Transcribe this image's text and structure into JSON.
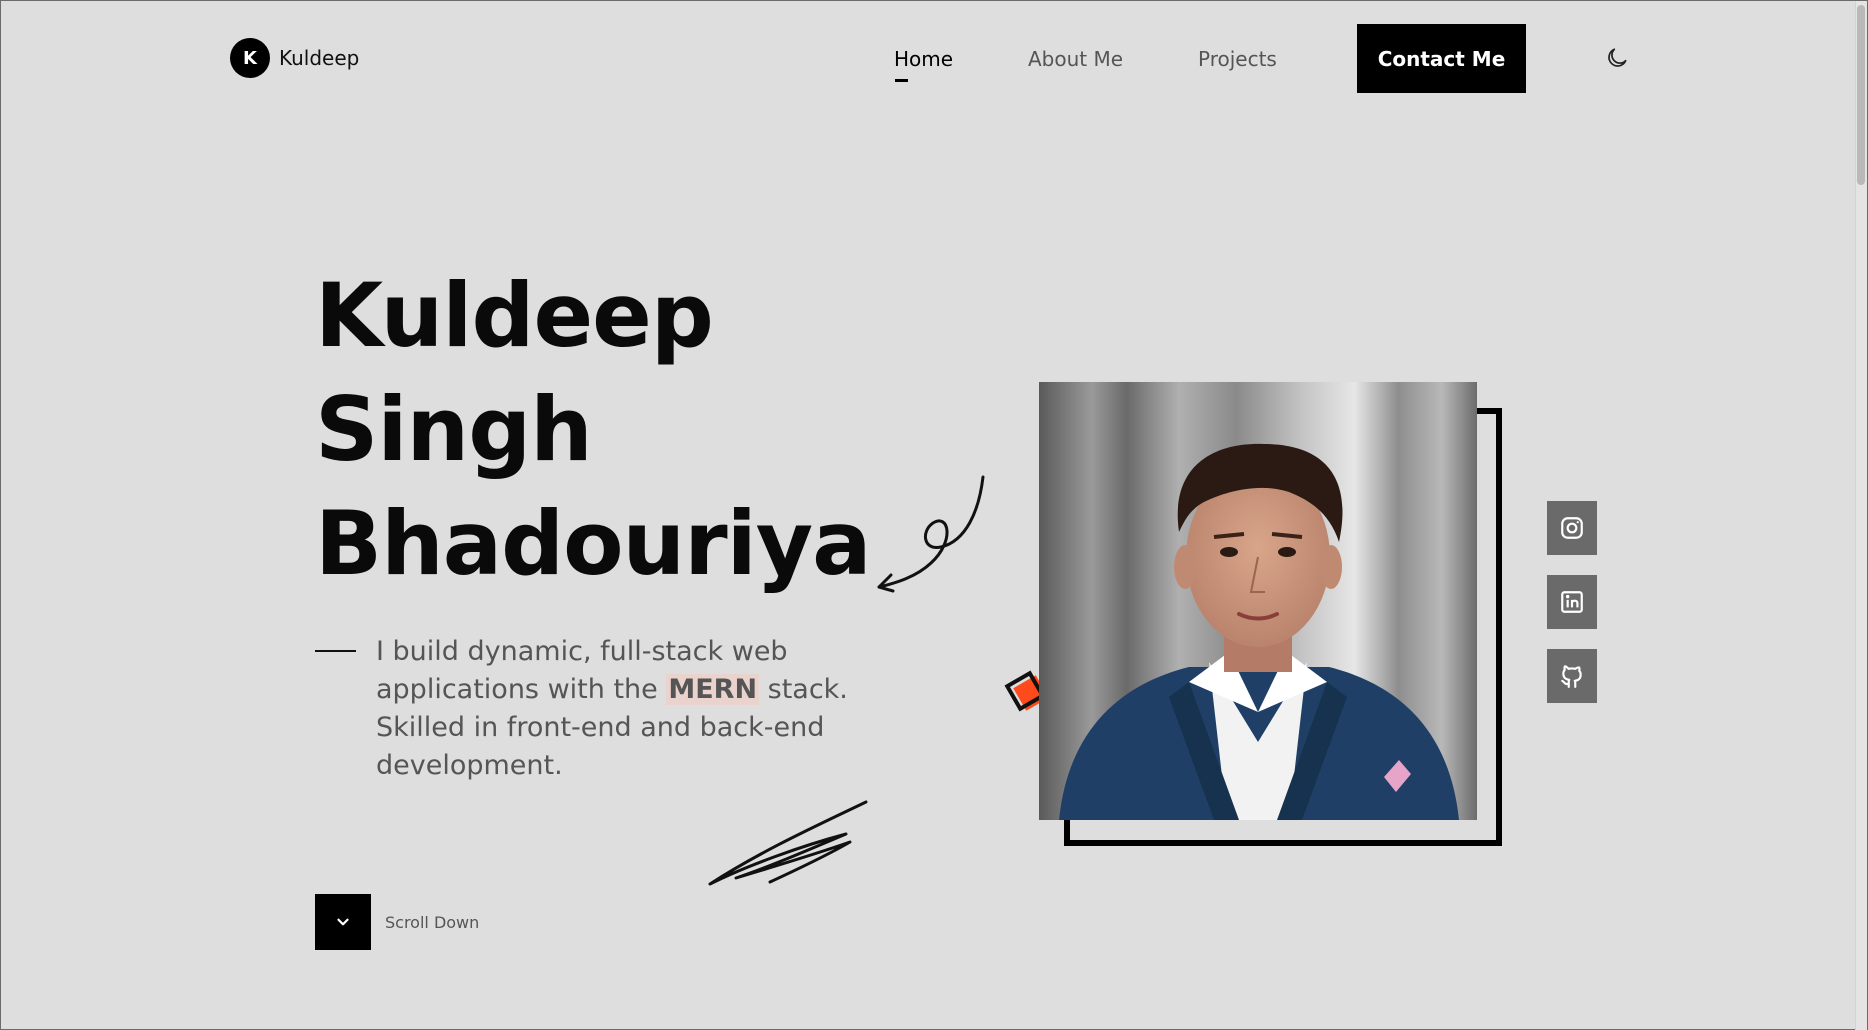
{
  "brand": {
    "logo_letter": "K",
    "name": "Kuldeep"
  },
  "nav": {
    "items": [
      {
        "label": "Home",
        "active": true
      },
      {
        "label": "About Me"
      },
      {
        "label": "Projects"
      }
    ],
    "contact_label": "Contact Me",
    "theme_icon": "moon-icon"
  },
  "hero": {
    "name_lines": [
      "Kuldeep",
      "Singh",
      "Bhadouriya"
    ],
    "description_before": "I build dynamic, full-stack web applications with the ",
    "description_highlight": "MERN",
    "description_after": " stack. Skilled in front-end and back-end development.",
    "scroll_label": "Scroll Down"
  },
  "social": [
    {
      "icon": "instagram-icon"
    },
    {
      "icon": "linkedin-icon"
    },
    {
      "icon": "github-icon"
    }
  ],
  "colors": {
    "background": "#dedede",
    "accent": "#ff4a1c",
    "dark": "#000000",
    "social_bg": "#6a6a6a"
  }
}
